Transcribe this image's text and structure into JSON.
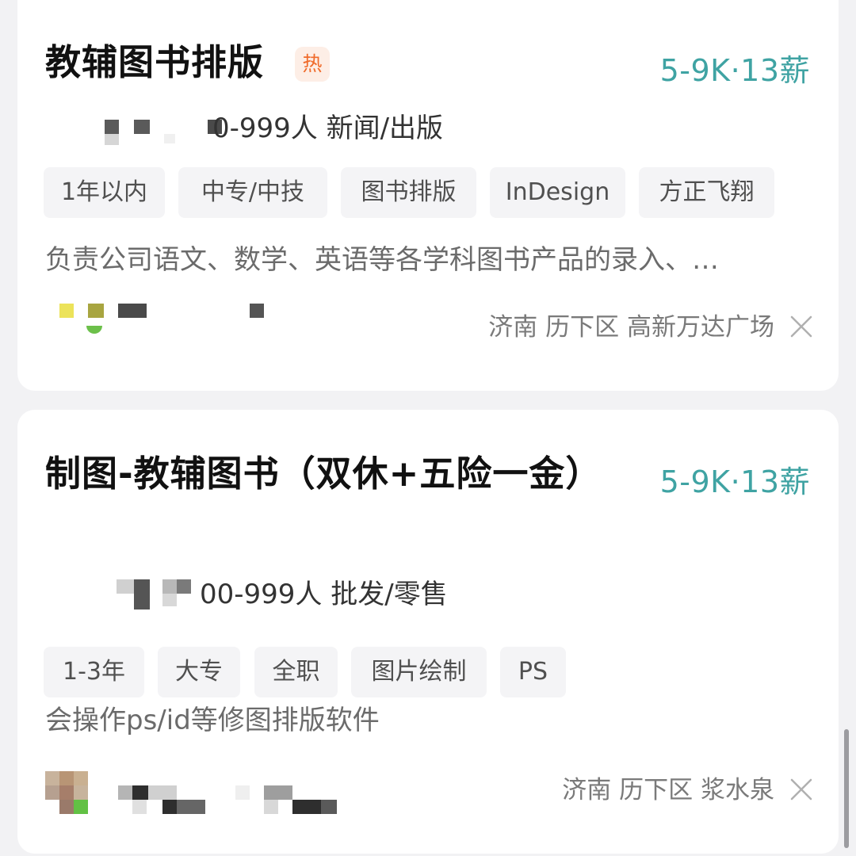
{
  "jobs": [
    {
      "title": "教辅图书排版",
      "hot_badge": "热",
      "salary": "5-9K·13薪",
      "company_info": "0-999人 新闻/出版",
      "tags": [
        "1年以内",
        "中专/中技",
        "图书排版",
        "InDesign",
        "方正飞翔"
      ],
      "description": "负责公司语文、数学、英语等各学科图书产品的录入、…",
      "location": "济南 历下区 高新万达广场"
    },
    {
      "title": "制图-教辅图书（双休+五险一金）",
      "salary": "5-9K·13薪",
      "company_info": "00-999人 批发/零售",
      "tags": [
        "1-3年",
        "大专",
        "全职",
        "图片绘制",
        "PS"
      ],
      "description": "会操作ps/id等修图排版软件",
      "location": "济南 历下区 浆水泉"
    }
  ],
  "icons": {
    "close": "close-icon"
  },
  "colors": {
    "salary": "#3fa3a3",
    "hot_badge": "#f06b2b",
    "background": "#f2f2f4"
  }
}
